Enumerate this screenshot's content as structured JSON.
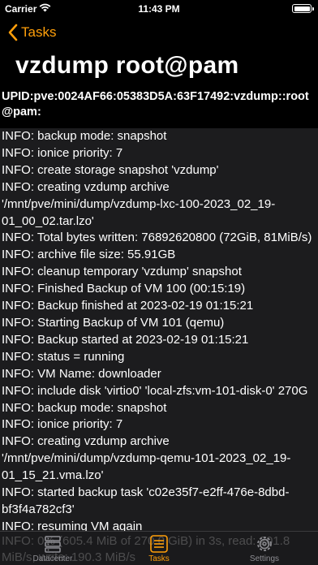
{
  "status_bar": {
    "carrier": "Carrier",
    "time": "11:43 PM"
  },
  "nav": {
    "back_label": "Tasks",
    "title": "vzdump  root@pam"
  },
  "task": {
    "upid": "UPID:pve:0024AF66:05383D5A:63F17492:vzdump::root@pam:"
  },
  "log_lines": [
    "INFO: backup mode: snapshot",
    "INFO: ionice priority: 7",
    "INFO: create storage snapshot 'vzdump'",
    "INFO: creating vzdump archive '/mnt/pve/mini/dump/vzdump-lxc-100-2023_02_19-01_00_02.tar.lzo'",
    "INFO: Total bytes written: 76892620800 (72GiB, 81MiB/s)",
    "INFO: archive file size: 55.91GB",
    "INFO: cleanup temporary 'vzdump' snapshot",
    "INFO: Finished Backup of VM 100 (00:15:19)",
    "INFO: Backup finished at 2023-02-19 01:15:21",
    "INFO: Starting Backup of VM 101 (qemu)",
    "INFO: Backup started at 2023-02-19 01:15:21",
    "INFO: status = running",
    "INFO: VM Name: downloader",
    "INFO: include disk 'virtio0' 'local-zfs:vm-101-disk-0' 270G",
    "INFO: backup mode: snapshot",
    "INFO: ionice priority: 7",
    "INFO: creating vzdump archive '/mnt/pve/mini/dump/vzdump-qemu-101-2023_02_19-01_15_21.vma.lzo'",
    "INFO: started backup task 'c02e35f7-e2ff-476e-8dbd-bf3f4a782cf3'",
    "INFO: resuming VM again"
  ],
  "tab_bar": {
    "ghost_line_1": "INFO: 0% (605.4 MiB of 270.0 GiB) in 3s, read: 201.8",
    "ghost_line_2": "MiB/s, write: 190.3 MiB/s",
    "tabs": [
      {
        "label": "Datacenter",
        "icon": "server-rack-icon",
        "active": false
      },
      {
        "label": "Tasks",
        "icon": "list-icon",
        "active": true
      },
      {
        "label": "Settings",
        "icon": "gear-icon",
        "active": false
      }
    ],
    "accent_color": "#ff9f0a",
    "inactive_color": "#8e8e93"
  },
  "colors": {
    "background": "#000000",
    "log_background": "#1c1c1e",
    "accent": "#ff9f0a"
  }
}
